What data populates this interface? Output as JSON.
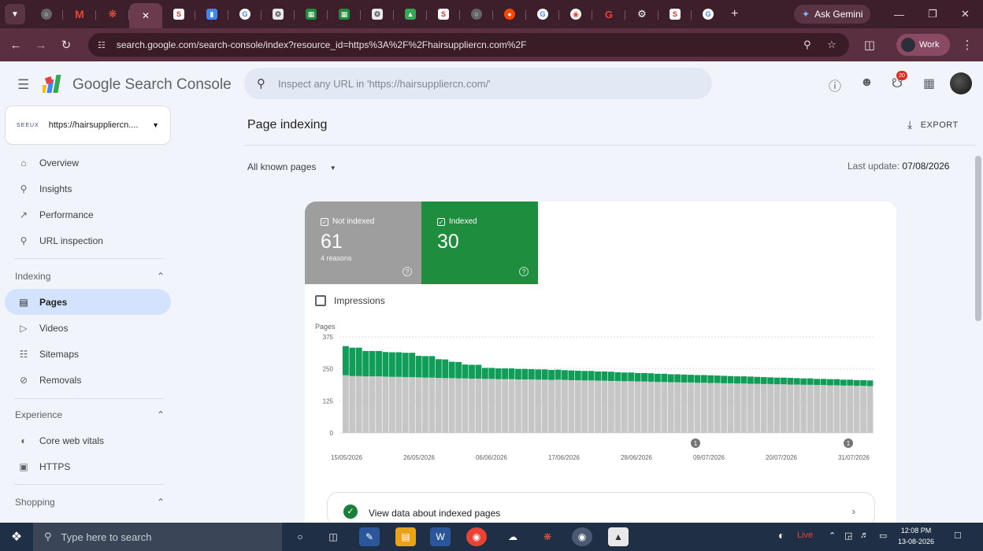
{
  "browser": {
    "gemini_label": "Ask Gemini",
    "address": "search.google.com/search-console/index?resource_id=https%3A%2F%2Fhairsuppliercn.com%2F",
    "profile_label": "Work"
  },
  "app": {
    "brand": "Google Search Console",
    "search_placeholder": "Inspect any URL in 'https://hairsuppliercn.com/'",
    "notification_count": "20"
  },
  "property": {
    "logo_text": "SEEUX",
    "url": "https://hairsuppliercn...."
  },
  "sidebar": {
    "top_items": [
      {
        "label": "Overview"
      },
      {
        "label": "Insights"
      },
      {
        "label": "Performance"
      },
      {
        "label": "URL inspection"
      }
    ],
    "indexing_heading": "Indexing",
    "indexing_items": [
      {
        "label": "Pages"
      },
      {
        "label": "Videos"
      },
      {
        "label": "Sitemaps"
      },
      {
        "label": "Removals"
      }
    ],
    "experience_heading": "Experience",
    "experience_items": [
      {
        "label": "Core web vitals"
      },
      {
        "label": "HTTPS"
      }
    ],
    "shopping_heading": "Shopping"
  },
  "main": {
    "title": "Page indexing",
    "export_label": "EXPORT",
    "filter_label": "All known pages",
    "last_update_label": "Last update:",
    "last_update_value": "07/08/2026",
    "not_indexed": {
      "label": "Not indexed",
      "value": "61",
      "sub": "4 reasons"
    },
    "indexed": {
      "label": "Indexed",
      "value": "30"
    },
    "impressions_label": "Impressions",
    "view_data_label": "View data about indexed pages"
  },
  "colors": {
    "not_indexed": "#9e9e9e",
    "indexed": "#1e8e3e",
    "bar_gray": "#c6c6c6",
    "bar_green": "#0f9d58"
  },
  "chart_data": {
    "type": "bar",
    "ylabel": "Pages",
    "yticks": [
      "375",
      "250",
      "125",
      "0"
    ],
    "ylim": [
      0,
      375
    ],
    "xticks": [
      "15/05/2026",
      "26/05/2026",
      "06/06/2026",
      "17/06/2026",
      "28/06/2026",
      "09/07/2026",
      "20/07/2026",
      "31/07/2026"
    ],
    "series": [
      {
        "name": "Not indexed",
        "values": [
          225,
          222,
          222,
          221,
          221,
          221,
          220,
          219,
          219,
          218,
          218,
          217,
          216,
          216,
          215,
          214,
          214,
          213,
          213,
          212,
          212,
          211,
          211,
          210,
          210,
          210,
          209,
          209,
          209,
          208,
          208,
          207,
          208,
          207,
          206,
          206,
          205,
          205,
          204,
          204,
          203,
          203,
          202,
          202,
          201,
          201,
          200,
          199,
          199,
          198,
          198,
          197,
          197,
          196,
          196,
          195,
          195,
          194,
          194,
          193,
          193,
          192,
          192,
          191,
          191,
          190,
          190,
          189,
          189,
          188,
          188,
          187,
          187,
          186,
          186,
          185,
          185,
          184,
          184,
          183
        ]
      },
      {
        "name": "Indexed",
        "values": [
          114,
          111,
          111,
          99,
          99,
          99,
          96,
          96,
          96,
          95,
          95,
          84,
          84,
          84,
          73,
          73,
          64,
          64,
          54,
          54,
          54,
          43,
          43,
          42,
          42,
          42,
          41,
          41,
          40,
          40,
          40,
          39,
          39,
          38,
          38,
          37,
          37,
          37,
          36,
          36,
          36,
          34,
          34,
          34,
          33,
          33,
          33,
          32,
          32,
          31,
          31,
          31,
          30,
          30,
          30,
          30,
          29,
          29,
          28,
          28,
          28,
          28,
          27,
          27,
          26,
          26,
          26,
          26,
          25,
          25,
          25,
          24,
          24,
          24,
          24,
          23,
          23,
          22,
          22,
          22
        ]
      }
    ],
    "annotation_markers": [
      "1",
      "1"
    ]
  },
  "taskbar": {
    "search_placeholder": "Type here to search",
    "weather": "Live",
    "time": "12:08 PM",
    "date": "13-08-2026"
  }
}
